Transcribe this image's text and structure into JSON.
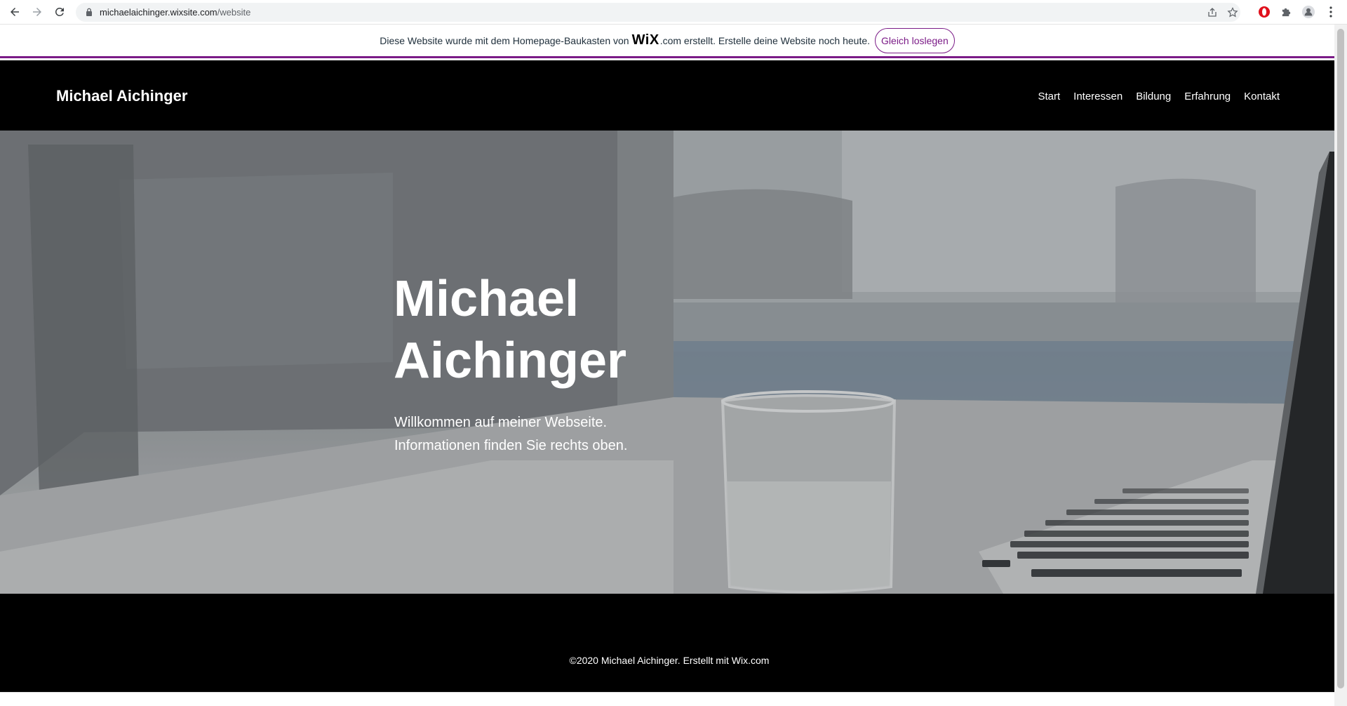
{
  "browser": {
    "url_host": "michaelaichinger.wixsite.com",
    "url_path": "/website",
    "icons": [
      "back-arrow-icon",
      "forward-arrow-icon",
      "reload-icon",
      "lock-icon",
      "share-icon",
      "star-icon",
      "opera-icon",
      "puzzle-icon",
      "profile-icon",
      "kebab-menu-icon"
    ]
  },
  "banner": {
    "text_before": "Diese Website wurde mit dem Homepage-Baukasten von",
    "logo": "WiX",
    "text_after": ".com erstellt. Erstelle deine Website noch heute.",
    "cta": "Gleich loslegen",
    "accent_color": "#7b1b87"
  },
  "header": {
    "site_title": "Michael Aichinger",
    "nav": [
      {
        "label": "Start"
      },
      {
        "label": "Interessen"
      },
      {
        "label": "Bildung"
      },
      {
        "label": "Erfahrung"
      },
      {
        "label": "Kontakt"
      }
    ]
  },
  "hero": {
    "title_line1": "Michael",
    "title_line2": "Aichinger",
    "subtitle_line1": "Willkommen auf meiner Webseite.",
    "subtitle_line2": "Informationen finden Sie rechts oben."
  },
  "footer": {
    "text": "©2020 Michael Aichinger. Erstellt mit Wix.com"
  }
}
